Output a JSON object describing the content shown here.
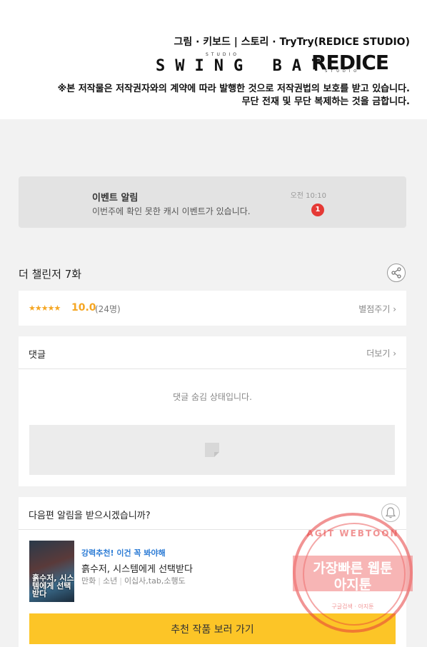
{
  "credits": {
    "line": "그림 · 키보드 | 스토리 · TryTry(REDICE STUDIO)",
    "swing_logo": "SWING BAT",
    "swing_sub": "STUDIO",
    "redice_logo": "REDICE",
    "redice_sub": "STUDIO",
    "copyright_1": "※본 저작물은 저작권자와의 계약에 따라 발행한 것으로 저작권법의 보호를 받고 있습니다.",
    "copyright_2": "무단 전재 및 무단 복제하는 것을 금합니다."
  },
  "notice": {
    "title": "이벤트 알림",
    "desc": "이번주에 확인 못한 캐시 이벤트가 있습니다.",
    "time": "오전 10:10",
    "badge": "1"
  },
  "episode": {
    "title": "더 챌린저 7화"
  },
  "rating": {
    "stars": "★★★★★",
    "score": "10.0",
    "count": "(24명)",
    "rate_link": "별점주기 ›"
  },
  "comments": {
    "label": "댓글",
    "more": "더보기 ›",
    "hidden_msg": "댓글 숨김 상태입니다."
  },
  "next": {
    "question": "다음편 알림을 받으시겠습니까?",
    "rec_tag": "강력추천! 이건 꼭 봐야해",
    "rec_title": "흙수저, 시스템에게 선택받다",
    "tag1": "만화",
    "tag2": "소년",
    "tag3": "이십사,tab,소행도",
    "thumb_title": "흙수저, 시스템에게 선택받다",
    "button": "추천 작품 보러 가기"
  },
  "watermark": {
    "top": "AGIT WEBTOON",
    "line1": "가장빠른 웹툰",
    "line2": "아지툰",
    "bottom": "구글검색 · 아지툰"
  },
  "colors": {
    "accent": "#fcc527",
    "badge": "#e53935",
    "star": "#f5a623",
    "link_blue": "#2b7bd5"
  }
}
